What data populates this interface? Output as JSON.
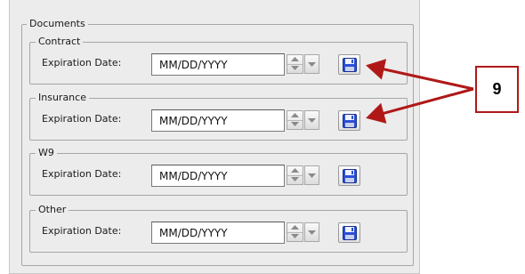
{
  "group_title": "Documents",
  "expiration_label": "Expiration Date:",
  "sections": [
    {
      "title": "Contract",
      "date_value": "MM/DD/YYYY"
    },
    {
      "title": "Insurance",
      "date_value": "MM/DD/YYYY"
    },
    {
      "title": "W9",
      "date_value": "MM/DD/YYYY"
    },
    {
      "title": "Other",
      "date_value": "MM/DD/YYYY"
    }
  ],
  "callout": {
    "label": "9"
  },
  "icons": {
    "save": "floppy-disk-icon",
    "spinner": "up-down-spinner-icon",
    "dropdown": "chevron-down-icon"
  },
  "colors": {
    "annotation": "#b01818",
    "floppy": "#2a4fd6"
  }
}
